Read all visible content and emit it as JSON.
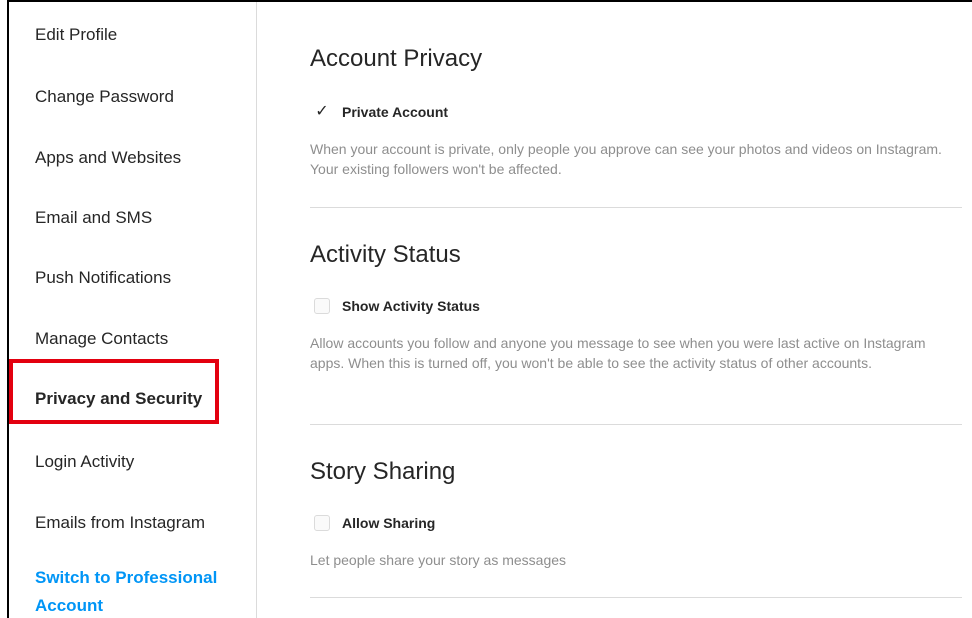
{
  "sidebar": {
    "items": [
      {
        "label": "Edit Profile"
      },
      {
        "label": "Change Password"
      },
      {
        "label": "Apps and Websites"
      },
      {
        "label": "Email and SMS"
      },
      {
        "label": "Push Notifications"
      },
      {
        "label": "Manage Contacts"
      },
      {
        "label": "Privacy and Security"
      },
      {
        "label": "Login Activity"
      },
      {
        "label": "Emails from Instagram"
      },
      {
        "label": "Switch to Professional Account"
      }
    ],
    "active_item": "Privacy and Security",
    "highlight_color": "#e3000f",
    "accent_color": "#0095f6"
  },
  "sections": [
    {
      "title": "Account Privacy",
      "option_label": "Private Account",
      "checked": true,
      "description": "When your account is private, only people you approve can see your photos and videos on Instagram. Your existing followers won't be affected."
    },
    {
      "title": "Activity Status",
      "option_label": "Show Activity Status",
      "checked": false,
      "description": "Allow accounts you follow and anyone you message to see when you were last active on Instagram apps. When this is turned off, you won't be able to see the activity status of other accounts."
    },
    {
      "title": "Story Sharing",
      "option_label": "Allow Sharing",
      "checked": false,
      "description": "Let people share your story as messages"
    }
  ],
  "icons": {
    "checkmark": "check-icon"
  }
}
